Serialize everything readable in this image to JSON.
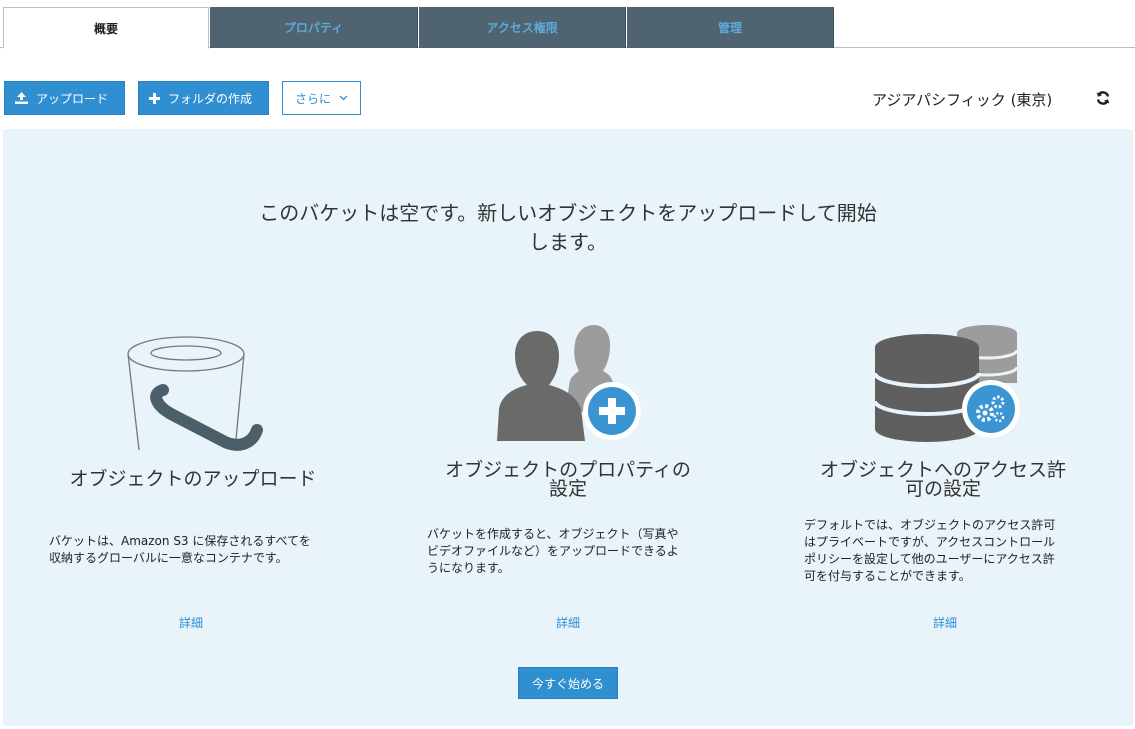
{
  "tabs": [
    {
      "label": "概要"
    },
    {
      "label": "プロパティ"
    },
    {
      "label": "アクセス権限"
    },
    {
      "label": "管理"
    }
  ],
  "toolbar": {
    "upload_label": "アップロード",
    "create_folder_label": "フォルダの作成",
    "more_label": "さらに"
  },
  "region": "アジアパシフィック (東京)",
  "empty_state": {
    "headline_line1": "このバケットは空です。新しいオブジェクトをアップロードして開始",
    "headline_line2": "します。",
    "columns": [
      {
        "title": "オブジェクトのアップロード",
        "desc_line1": "バケットは、Amazon S3 に保存されるすべてを",
        "desc_line2": "収納するグローバルに一意なコンテナです。",
        "link": "詳細"
      },
      {
        "title_line1": "オブジェクトのプロパティの",
        "title_line2": "設定",
        "desc_line1": "バケットを作成すると、オブジェクト（写真や",
        "desc_line2": "ビデオファイルなど）をアップロードできるよ",
        "desc_line3": "うになります。",
        "link": "詳細"
      },
      {
        "title_line1": "オブジェクトへのアクセス許",
        "title_line2": "可の設定",
        "desc_line1": "デフォルトでは、オブジェクトのアクセス許可",
        "desc_line2": "はプライベートですが、アクセスコントロール",
        "desc_line3": "ポリシーを設定して他のユーザーにアクセス許",
        "desc_line4": "可を付与することができます。",
        "link": "詳細"
      }
    ],
    "start_label": "今すぐ始める"
  },
  "colors": {
    "accent": "#2f8fd0",
    "tab_dark": "#4f6470",
    "panel_bg": "#e8f3fa"
  }
}
